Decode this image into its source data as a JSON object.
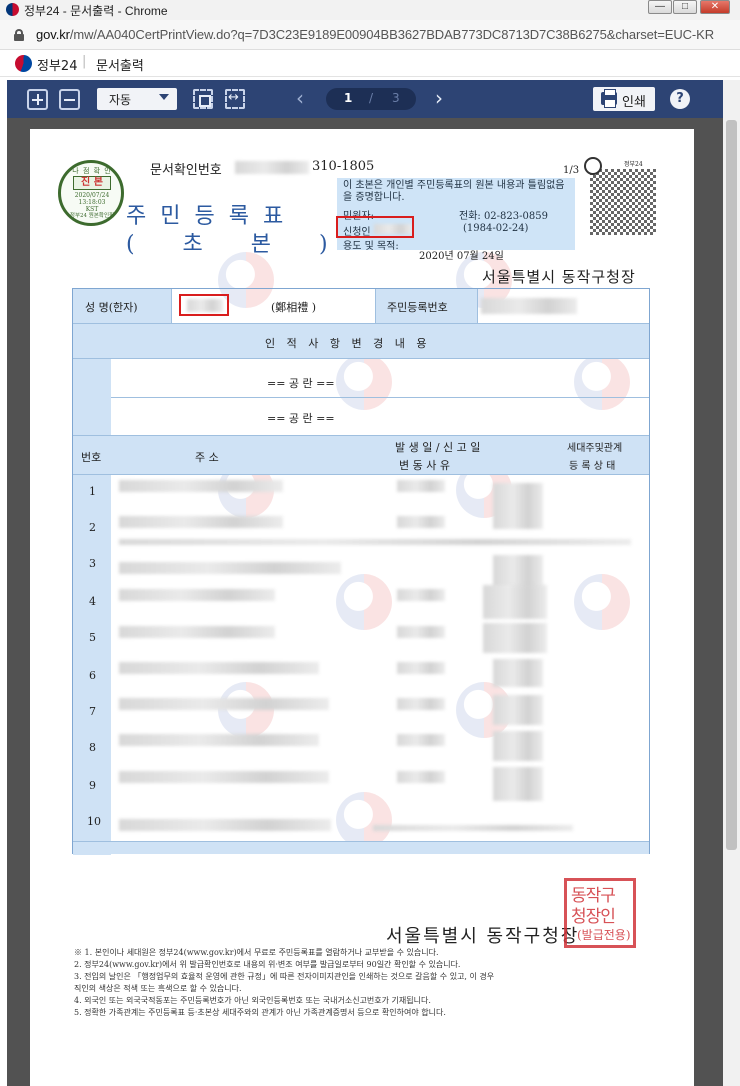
{
  "window": {
    "title": "정부24 - 문서출력 - Chrome"
  },
  "address": {
    "host": "gov.kr",
    "path": "/mw/AA040CertPrintView.do?q=7D3C23E9189E00904BB3627BDAB773DC8713D7C38B6275&charset=EUC-KR"
  },
  "site": {
    "name": "정부24",
    "separator": "|",
    "section": "문서출력"
  },
  "toolbar": {
    "zoom": "자동",
    "current_page": "1",
    "page_sep": "/",
    "total_pages": "3",
    "print_label": "인쇄",
    "help": "?"
  },
  "document": {
    "cert_no_label": "문서확인번호",
    "cert_no_tail": "310-1805",
    "page_count": "1/3",
    "qr_brand": "정부24",
    "seal": {
      "top": "나 점 확 인 용",
      "main": "진 본",
      "date": "2020/07/24\n13:18:03\nKST",
      "bottom": "정부24 원본확인필"
    },
    "title": "주민등록표",
    "subtitle": "(    초    본    )",
    "notice_text": "이 초본은 개인별 주민등록표의 원본 내용과 틀림없음을 증명합니다.",
    "applicant_label": "민원자:",
    "tel": "전화: 02-823-0859",
    "name_prefix": "신청인",
    "birth": "(1984-02-24)",
    "purpose": "용도 및 목적:",
    "issue_date": "2020년 07월 24일",
    "issuer_top": "서울특별시 동작구청장",
    "issuer_bottom": "서울특별시 동작구청장",
    "stamp": {
      "line1": "동작구",
      "line2": "청장인",
      "line3": "(발급전용)"
    },
    "table": {
      "name_label": "성 명(한자)",
      "hanja": "(鄭相禮        )",
      "rrn_label": "주민등록번호",
      "change_header": "인 적 사 항 변 경 내 용",
      "blank1": "==       공       란       ==",
      "blank2": "==       공       란       ==",
      "col_no": "번호",
      "col_addr": "주                  소",
      "col_date1": "발 생 일  /  신 고 일",
      "col_date2": "변     동     사     유",
      "col_house1": "세대주및관계",
      "col_house2": "등 록 상 태",
      "rows": [
        "1",
        "2",
        "3",
        "4",
        "5",
        "6",
        "7",
        "8",
        "9",
        "10"
      ]
    },
    "notes": [
      "※ 1. 본인이나 세대원은 정부24(www.gov.kr)에서 무료로 주민등록표를 열람하거나 교부받을 수 있습니다.",
      "   2. 정부24(www.gov.kr)에서 위 발급확인번호로 내용의 위·변조 여부를 발급일로부터 90일간 확인할 수 있습니다.",
      "   3. 전입의 날인은 「행정업무의 효율적 운영에 관한 규정」에 따른 전자이미지관인을 인쇄하는 것으로 갈음할 수 있고, 이 경우",
      "      직인의 색상은 적색 또는 흑색으로 할 수 있습니다.",
      "   4. 외국인 또는 외국국적동포는 주민등록번호가 아닌 외국인등록번호 또는 국내거소신고번호가 기재됩니다.",
      "   5. 정확한 가족관계는 주민등록표 등·초본상 세대주와의 관계가 아닌 가족관계증명서 등으로 확인하여야 합니다."
    ]
  },
  "colors": {
    "toolbar": "#2d4474",
    "accent_blue": "#2c5aa0",
    "highlight": "#cfe2f5",
    "stamp_red": "#d1343a"
  }
}
